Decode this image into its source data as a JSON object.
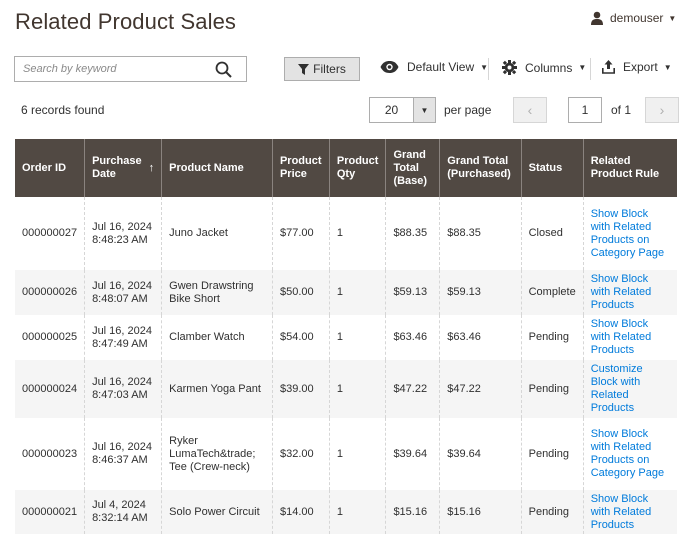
{
  "page": {
    "title": "Related Product Sales"
  },
  "user": {
    "name": "demouser"
  },
  "search": {
    "placeholder": "Search by keyword",
    "value": ""
  },
  "toolbar": {
    "filters_label": "Filters",
    "view_label": "Default View",
    "columns_label": "Columns",
    "export_label": "Export"
  },
  "records": {
    "summary": "6 records found"
  },
  "pagination": {
    "per_page": "20",
    "per_page_label": "per page",
    "current_page": "1",
    "of_label": "of 1"
  },
  "grid": {
    "headers": {
      "order_id": "Order ID",
      "purchase_date": "Purchase Date",
      "product_name": "Product Name",
      "product_price": "Product Price",
      "product_qty": "Product Qty",
      "grand_total_base": "Grand Total (Base)",
      "grand_total_purchased": "Grand Total (Purchased)",
      "status": "Status",
      "related_product_rule": "Related Product Rule"
    },
    "sort_indicator": "↑",
    "rows": [
      {
        "order_id": "000000027",
        "date": "Jul 16, 2024",
        "time": "8:48:23 AM",
        "product": "Juno Jacket",
        "price": "$77.00",
        "qty": "1",
        "total_base": "$88.35",
        "total_purchased": "$88.35",
        "status": "Closed",
        "rule": "Show Block with Related Products on Category Page"
      },
      {
        "order_id": "000000026",
        "date": "Jul 16, 2024",
        "time": "8:48:07 AM",
        "product": "Gwen Drawstring Bike Short",
        "price": "$50.00",
        "qty": "1",
        "total_base": "$59.13",
        "total_purchased": "$59.13",
        "status": "Complete",
        "rule": "Show Block with Related Products"
      },
      {
        "order_id": "000000025",
        "date": "Jul 16, 2024",
        "time": "8:47:49 AM",
        "product": "Clamber Watch",
        "price": "$54.00",
        "qty": "1",
        "total_base": "$63.46",
        "total_purchased": "$63.46",
        "status": "Pending",
        "rule": "Show Block with Related Products"
      },
      {
        "order_id": "000000024",
        "date": "Jul 16, 2024",
        "time": "8:47:03 AM",
        "product": "Karmen Yoga Pant",
        "price": "$39.00",
        "qty": "1",
        "total_base": "$47.22",
        "total_purchased": "$47.22",
        "status": "Pending",
        "rule": "Customize Block with Related Products"
      },
      {
        "order_id": "000000023",
        "date": "Jul 16, 2024",
        "time": "8:46:37 AM",
        "product": "Ryker LumaTech&trade; Tee (Crew-neck)",
        "price": "$32.00",
        "qty": "1",
        "total_base": "$39.64",
        "total_purchased": "$39.64",
        "status": "Pending",
        "rule": "Show Block with Related Products on Category Page"
      },
      {
        "order_id": "000000021",
        "date": "Jul 4, 2024",
        "time": "8:32:14 AM",
        "product": "Solo Power Circuit",
        "price": "$14.00",
        "qty": "1",
        "total_base": "$15.16",
        "total_purchased": "$15.16",
        "status": "Pending",
        "rule": "Show Block with Related Products"
      }
    ]
  },
  "colors": {
    "header_bg": "#514943",
    "link": "#007bdb",
    "title": "#41362f"
  },
  "icons": {
    "user": "user-icon",
    "search": "search-icon",
    "filter": "funnel-icon",
    "view": "eye-icon",
    "columns": "gear-icon",
    "export": "upload-icon"
  }
}
